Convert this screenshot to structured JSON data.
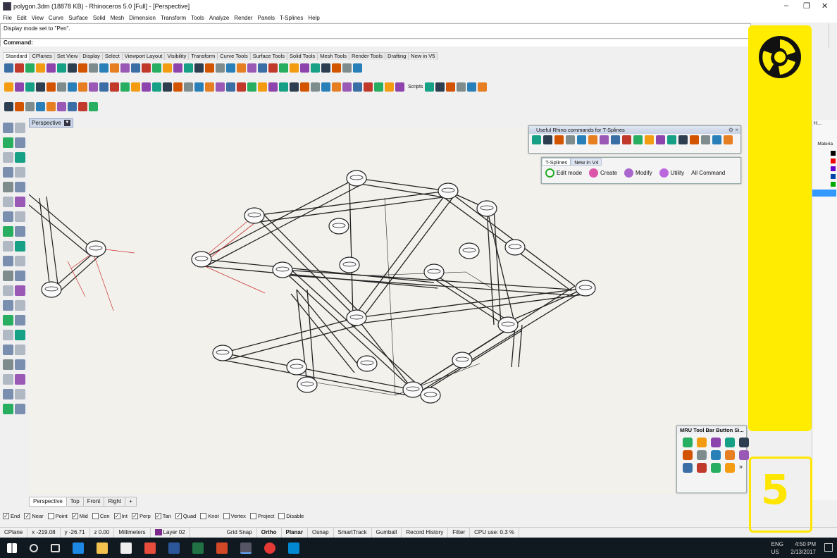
{
  "window": {
    "title": "polygon.3dm (18878 KB) - Rhinoceros 5.0 [Full] - [Perspective]",
    "minimize": "–",
    "restore": "❐",
    "close": "✕"
  },
  "menu": [
    "File",
    "Edit",
    "View",
    "Curve",
    "Surface",
    "Solid",
    "Mesh",
    "Dimension",
    "Transform",
    "Tools",
    "Analyze",
    "Render",
    "Panels",
    "T-Splines",
    "Help"
  ],
  "command": {
    "history": "Display mode set to \"Pen\".",
    "prompt": "Command:"
  },
  "toolbar_tabs": [
    "Standard",
    "CPlanes",
    "Set View",
    "Display",
    "Select",
    "Viewport Layout",
    "Visibility",
    "Transform",
    "Curve Tools",
    "Surface Tools",
    "Solid Tools",
    "Mesh Tools",
    "Render Tools",
    "Drafting",
    "New in V5"
  ],
  "scripts_label": "Scripts",
  "viewport": {
    "label": "Perspective",
    "tabs": [
      "Perspective",
      "Top",
      "Front",
      "Right"
    ],
    "add_tab": "+"
  },
  "useful_panel": {
    "title": "Useful Rhino commands for T-Splines"
  },
  "tsplines_panel": {
    "tabs": [
      "T-Splines",
      "New in V4"
    ],
    "buttons": [
      "Edit mode",
      "Create",
      "Modify",
      "Utility",
      "All Command"
    ]
  },
  "mru_panel": {
    "title": "MRU Tool Bar Button Si...",
    "more": "»"
  },
  "right_panel": {
    "header": "H...",
    "material_label": "Materia"
  },
  "osnap": [
    {
      "label": "End",
      "checked": true
    },
    {
      "label": "Near",
      "checked": true
    },
    {
      "label": "Point",
      "checked": false
    },
    {
      "label": "Mid",
      "checked": true
    },
    {
      "label": "Cen",
      "checked": false
    },
    {
      "label": "Int",
      "checked": true
    },
    {
      "label": "Perp",
      "checked": true
    },
    {
      "label": "Tan",
      "checked": true
    },
    {
      "label": "Quad",
      "checked": true
    },
    {
      "label": "Knot",
      "checked": false
    },
    {
      "label": "Vertex",
      "checked": false
    },
    {
      "label": "Project",
      "checked": false
    },
    {
      "label": "Disable",
      "checked": false
    }
  ],
  "status": {
    "cplane": "CPlane",
    "x": "x -219.08",
    "y": "y -26.71",
    "z": "z 0.00",
    "units": "Millimeters",
    "layer": "Layer 02",
    "grid_snap": "Grid Snap",
    "ortho": "Ortho",
    "planar": "Planar",
    "osnap": "Osnap",
    "smarttrack": "SmartTrack",
    "gumball": "Gumball",
    "record_history": "Record History",
    "filter": "Filter",
    "cpu": "CPU use: 0.3 %"
  },
  "tray": {
    "lang": "ENG",
    "region": "US",
    "time": "4:50 PM",
    "date": "2/13/2017"
  },
  "overlay": {
    "step_number": "5"
  },
  "colors": {
    "overlay_yellow": "#ffec00",
    "viewport_bg": "#f2f1ec",
    "taskbar_bg": "#101820",
    "selection_blue": "#3399ff"
  }
}
